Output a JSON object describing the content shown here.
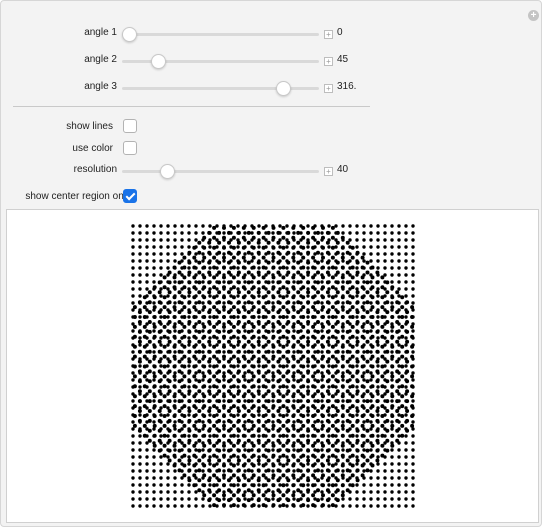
{
  "controls": {
    "angle1": {
      "label": "angle 1",
      "value": "0",
      "fraction": 0.0
    },
    "angle2": {
      "label": "angle 2",
      "value": "45",
      "fraction": 0.16
    },
    "angle3": {
      "label": "angle 3",
      "value": "316.",
      "fraction": 0.85
    },
    "show_lines": {
      "label": "show lines",
      "checked": false
    },
    "use_color": {
      "label": "use color",
      "checked": false
    },
    "resolution": {
      "label": "resolution",
      "value": "40",
      "fraction": 0.21
    },
    "show_center": {
      "label": "show center region only",
      "checked": true
    }
  },
  "colors": {
    "accent": "#1a73e8",
    "dots": "#000000"
  },
  "icons": {
    "corner": "plus-circle-icon",
    "stepper": "plus-square-icon"
  }
}
